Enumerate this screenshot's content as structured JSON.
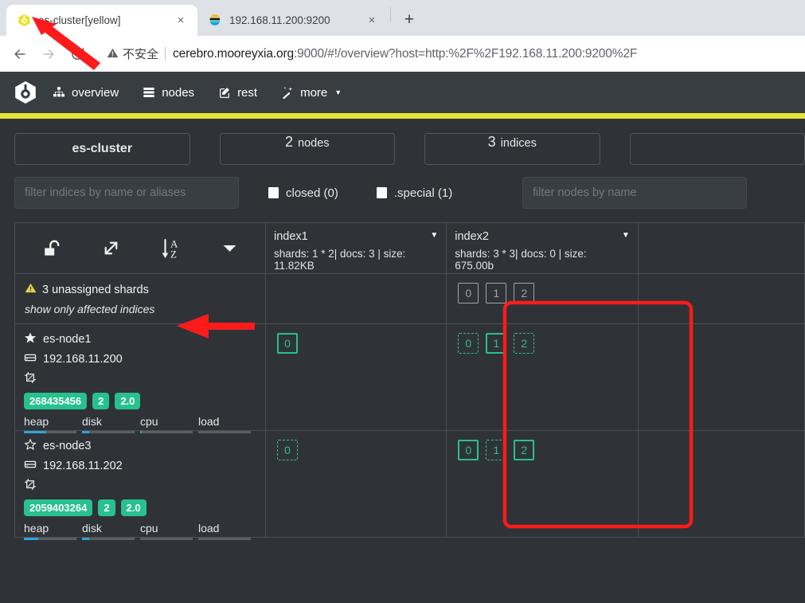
{
  "browser": {
    "tabs": [
      {
        "title": "es-cluster[yellow]",
        "favicon": "cerebro-icon",
        "active": true,
        "close_label": "×"
      },
      {
        "title": "192.168.11.200:9200",
        "favicon": "elasticsearch-icon",
        "active": false,
        "close_label": "×"
      }
    ],
    "new_tab_label": "+",
    "back_label": "←",
    "forward_label": "→",
    "reload_label": "↻",
    "security": {
      "icon": "warning-triangle-icon",
      "text": "不安全"
    },
    "url_prefix": "cerebro.mooreyxia.org",
    "url_suffix": ":9000/#!/overview?host=http:%2F%2F192.168.11.200:9200%2F"
  },
  "nav": {
    "brand_icon": "cerebro-logo-icon",
    "items": [
      {
        "label": "overview",
        "icon": "sitemap-icon"
      },
      {
        "label": "nodes",
        "icon": "server-list-icon"
      },
      {
        "label": "rest",
        "icon": "pencil-square-icon"
      },
      {
        "label": "more",
        "icon": "magic-wand-icon",
        "caret": "▼"
      }
    ],
    "status_color": "#e8e337"
  },
  "summary": {
    "cluster_name": "es-cluster",
    "nodes_count": "2",
    "nodes_label": "nodes",
    "indices_count": "3",
    "indices_label": "indices"
  },
  "filters": {
    "indices_placeholder": "filter indices by name or aliases",
    "nodes_placeholder": "filter nodes by name",
    "closed_label": "closed (0)",
    "special_label": ".special (1)"
  },
  "toolbar": {
    "lock_icon": "unlock-icon",
    "expand_icon": "expand-arrows-icon",
    "sort_icon": "sort-alpha-asc-icon",
    "caret_icon": "chevron-down-icon"
  },
  "indices": [
    {
      "name": "index1",
      "meta": "shards: 1 * 2| docs: 3 | size: 11.82KB",
      "caret": "▼"
    },
    {
      "name": "index2",
      "meta": "shards: 3 * 3| docs: 0 | size: 675.00b",
      "caret": "▼"
    }
  ],
  "unassigned": {
    "warn_icon": "warning-triangle-icon",
    "text": "3 unassigned shards",
    "link": "show only affected indices",
    "shards": {
      "index1": [],
      "index2": [
        {
          "id": "0",
          "state": "unassigned"
        },
        {
          "id": "1",
          "state": "unassigned"
        },
        {
          "id": "2",
          "state": "unassigned"
        }
      ]
    }
  },
  "nodes": [
    {
      "name": "es-node1",
      "master": true,
      "star_icon": "star-filled-icon",
      "host_icon": "server-icon",
      "host": "192.168.11.200",
      "role_icon": "master-node-icon",
      "badges": [
        "268435456",
        "2",
        "2.0"
      ],
      "metrics": [
        {
          "label": "heap",
          "fill_pct": 42
        },
        {
          "label": "disk",
          "fill_pct": 13
        },
        {
          "label": "cpu",
          "fill_pct": 3
        },
        {
          "label": "load",
          "fill_pct": 0
        }
      ],
      "shards": {
        "index1": [
          {
            "id": "0",
            "state": "primary"
          }
        ],
        "index2": [
          {
            "id": "0",
            "state": "replica"
          },
          {
            "id": "1",
            "state": "primary"
          },
          {
            "id": "2",
            "state": "replica"
          }
        ]
      }
    },
    {
      "name": "es-node3",
      "master": false,
      "star_icon": "star-outline-icon",
      "host_icon": "server-icon",
      "host": "192.168.11.202",
      "role_icon": "master-node-icon",
      "badges": [
        "2059403264",
        "2",
        "2.0"
      ],
      "metrics": [
        {
          "label": "heap",
          "fill_pct": 28
        },
        {
          "label": "disk",
          "fill_pct": 13
        },
        {
          "label": "cpu",
          "fill_pct": 0
        },
        {
          "label": "load",
          "fill_pct": 0
        }
      ],
      "shards": {
        "index1": [
          {
            "id": "0",
            "state": "replica"
          }
        ],
        "index2": [
          {
            "id": "0",
            "state": "primary"
          },
          {
            "id": "1",
            "state": "replica"
          },
          {
            "id": "2",
            "state": "primary"
          }
        ]
      }
    }
  ],
  "annotations": {
    "arrow_tab_color": "#fb1b1b",
    "arrow_unassigned_color": "#fb1b1b",
    "box_color": "#fb1b1b"
  },
  "colors": {
    "accent_green": "#27c18e",
    "unassigned_gray": "#a0a4a8",
    "status_yellow": "#e8e337",
    "metric_blue": "#2ea4e0",
    "app_bg": "#2f3337",
    "nav_bg": "#383d41"
  }
}
